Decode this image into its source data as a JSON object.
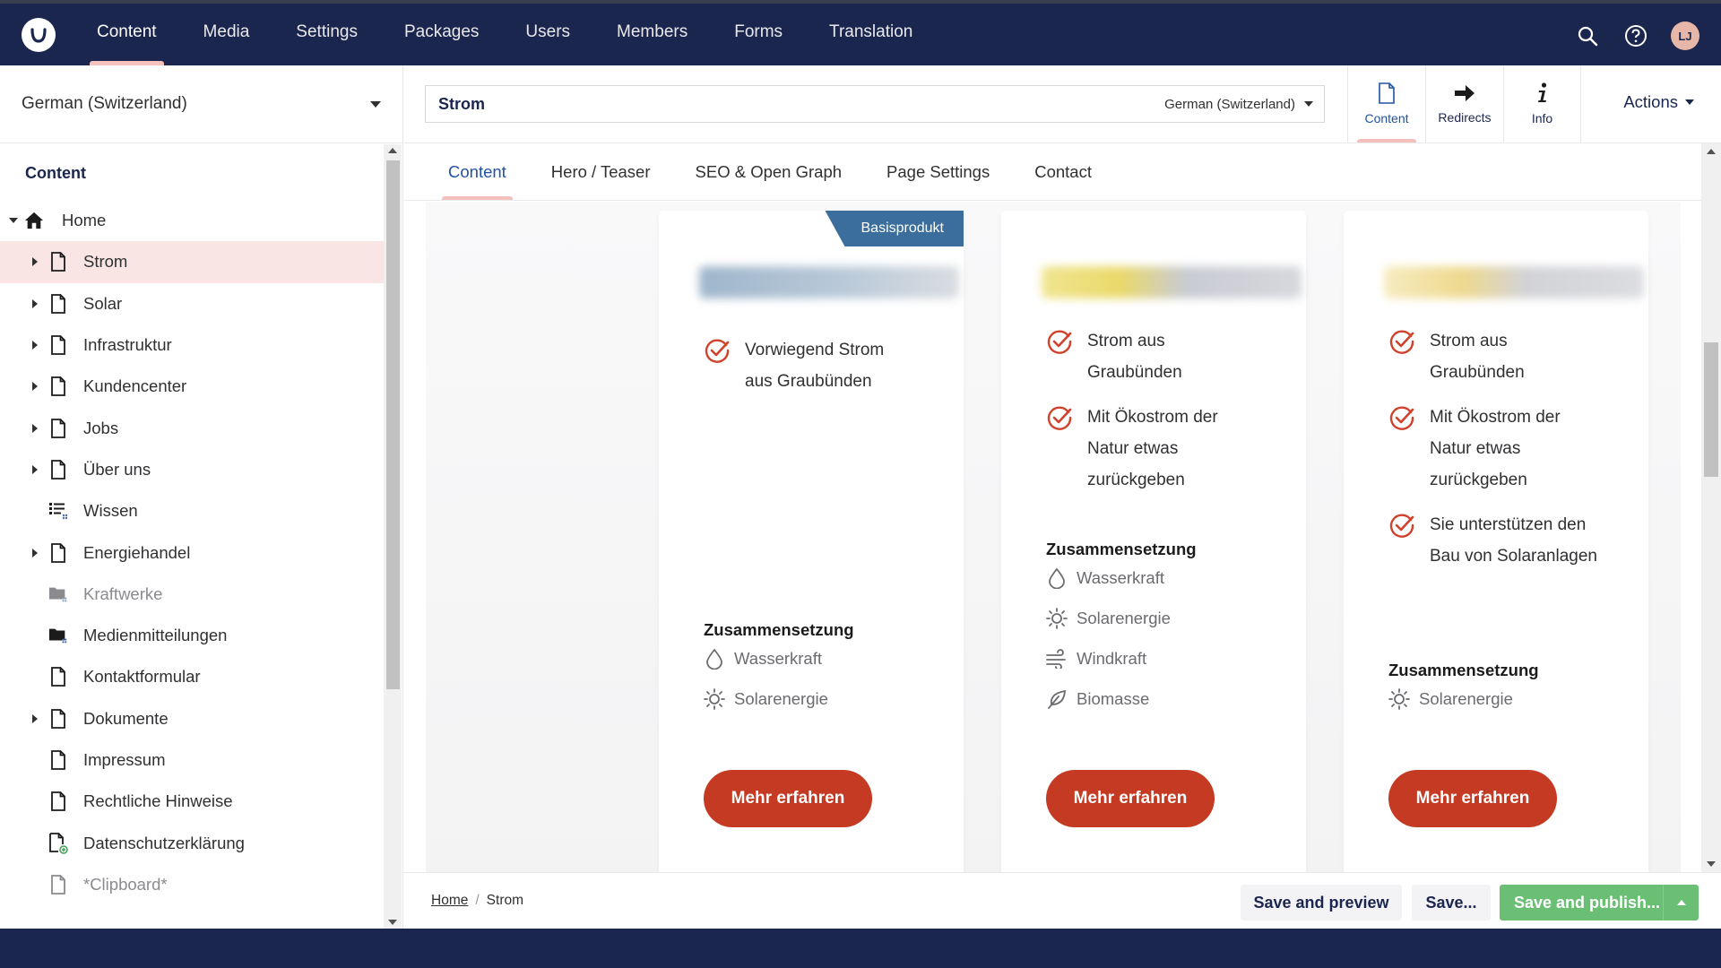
{
  "topnav": {
    "logo": "umbraco-logo-icon",
    "items": [
      "Content",
      "Media",
      "Settings",
      "Packages",
      "Users",
      "Members",
      "Forms",
      "Translation"
    ],
    "active_index": 0,
    "search_icon": "search-icon",
    "help_icon": "help-icon",
    "avatar_initials": "LJ"
  },
  "sidebar": {
    "culture": "German (Switzerland)",
    "tree_header": "Content",
    "root": {
      "label": "Home",
      "icon": "home-icon"
    },
    "items": [
      {
        "label": "Strom",
        "icon": "document-icon",
        "expandable": true,
        "selected": true
      },
      {
        "label": "Solar",
        "icon": "document-icon",
        "expandable": true
      },
      {
        "label": "Infrastruktur",
        "icon": "document-icon",
        "expandable": true
      },
      {
        "label": "Kundencenter",
        "icon": "document-icon",
        "expandable": true
      },
      {
        "label": "Jobs",
        "icon": "document-icon",
        "expandable": true
      },
      {
        "label": "Über uns",
        "icon": "document-icon",
        "expandable": true
      },
      {
        "label": "Wissen",
        "icon": "list-icon",
        "expandable": false
      },
      {
        "label": "Energiehandel",
        "icon": "document-icon",
        "expandable": true
      },
      {
        "label": "Kraftwerke",
        "icon": "folder-icon",
        "expandable": false,
        "muted": true
      },
      {
        "label": "Medienmitteilungen",
        "icon": "folder-icon",
        "expandable": false
      },
      {
        "label": "Kontaktformular",
        "icon": "document-icon",
        "expandable": false
      },
      {
        "label": "Dokumente",
        "icon": "document-icon",
        "expandable": true
      },
      {
        "label": "Impressum",
        "icon": "document-icon",
        "expandable": false
      },
      {
        "label": "Rechtliche Hinweise",
        "icon": "document-icon",
        "expandable": false
      },
      {
        "label": "Datenschutzerklärung",
        "icon": "document-add-icon",
        "expandable": false
      },
      {
        "label": "*Clipboard*",
        "icon": "document-icon",
        "expandable": false,
        "muted": true
      }
    ]
  },
  "editor": {
    "name": "Strom",
    "name_culture": "German (Switzerland)",
    "apps": [
      {
        "label": "Content",
        "icon": "document-icon",
        "active": true
      },
      {
        "label": "Redirects",
        "icon": "arrow-right-icon"
      },
      {
        "label": "Info",
        "icon": "info-icon"
      }
    ],
    "actions_label": "Actions",
    "tabs": [
      "Content",
      "Hero / Teaser",
      "SEO & Open Graph",
      "Page Settings",
      "Contact"
    ],
    "active_tab": 0
  },
  "preview": {
    "cards": [
      {
        "ribbon": "Basisprodukt",
        "logo_color": "#3b6e9c",
        "features": [
          [
            "Vorwiegend Strom",
            "aus Graubünden"
          ]
        ],
        "composition_title": "Zusammensetzung",
        "composition": [
          {
            "label": "Wasserkraft",
            "icon": "water-drop-icon"
          },
          {
            "label": "Solarenergie",
            "icon": "sun-icon"
          }
        ],
        "button": "Mehr erfahren"
      },
      {
        "ribbon": "",
        "logo_color": "#e8d870",
        "features": [
          [
            "Strom aus",
            "Graubünden"
          ],
          [
            "Mit Ökostrom der",
            "Natur etwas",
            "zurückgeben"
          ]
        ],
        "composition_title": "Zusammensetzung",
        "composition": [
          {
            "label": "Wasserkraft",
            "icon": "water-drop-icon"
          },
          {
            "label": "Solarenergie",
            "icon": "sun-icon"
          },
          {
            "label": "Windkraft",
            "icon": "wind-icon"
          },
          {
            "label": "Biomasse",
            "icon": "leaf-icon"
          }
        ],
        "button": "Mehr erfahren"
      },
      {
        "ribbon": "",
        "logo_color": "#f0d890",
        "features": [
          [
            "Strom aus",
            "Graubünden"
          ],
          [
            "Mit Ökostrom der",
            "Natur etwas",
            "zurückgeben"
          ],
          [
            "Sie unterstützen den",
            "Bau von Solaranlagen"
          ]
        ],
        "composition_title": "Zusammensetzung",
        "composition": [
          {
            "label": "Solarenergie",
            "icon": "sun-icon"
          }
        ],
        "button": "Mehr erfahren"
      }
    ]
  },
  "footer": {
    "breadcrumb": [
      "Home",
      "Strom"
    ],
    "save_preview": "Save and preview",
    "save": "Save...",
    "save_publish": "Save and publish..."
  },
  "colors": {
    "header_bg": "#1b264f",
    "accent_pink": "#f5c1bc",
    "active_blue": "#2152a3",
    "cta_red": "#c53a22",
    "publish_green": "#6bbf75",
    "ribbon_blue": "#3b6e9c"
  }
}
